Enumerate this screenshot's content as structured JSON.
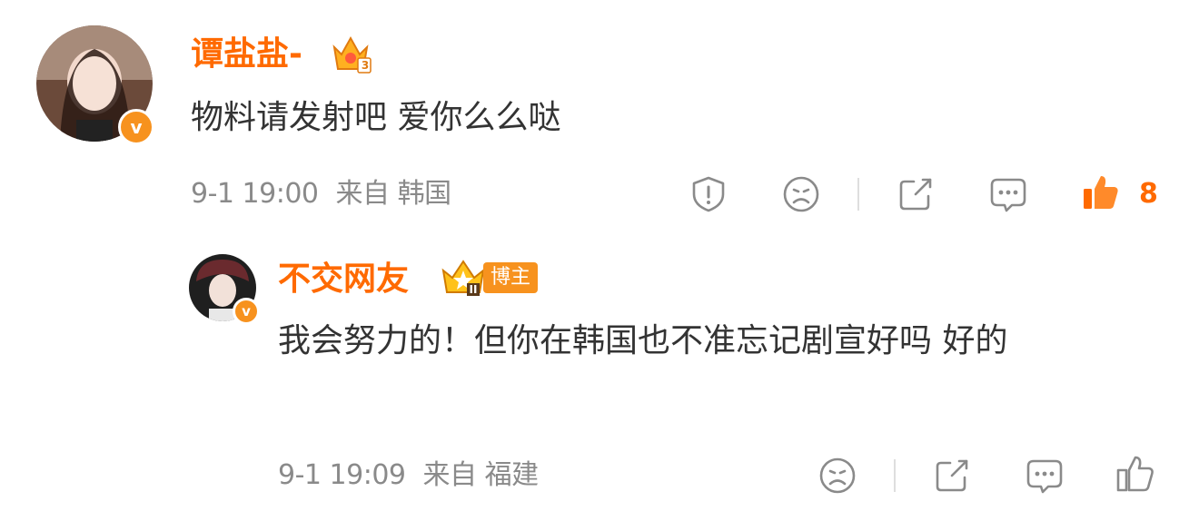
{
  "comment": {
    "author": "谭盐盐-",
    "text": "物料请发射吧 爱你么么哒",
    "time": "9-1 19:00",
    "source": "来自 韩国",
    "like_count": "8",
    "badge_letter": "v",
    "crown_level": "3"
  },
  "reply": {
    "author": "不交网友",
    "tag": "博主",
    "text": "我会努力的！但你在韩国也不准忘记剧宣好吗 好的",
    "time": "9-1 19:09",
    "source": "来自 福建",
    "badge_letter": "v",
    "crown_level": "II"
  },
  "icons": [
    "report-icon",
    "dislike-icon",
    "share-icon",
    "comment-icon",
    "like-icon"
  ],
  "colors": {
    "accent": "#ff6a00",
    "badge": "#f7921e",
    "text": "#333333",
    "meta": "#8a8a8a"
  }
}
